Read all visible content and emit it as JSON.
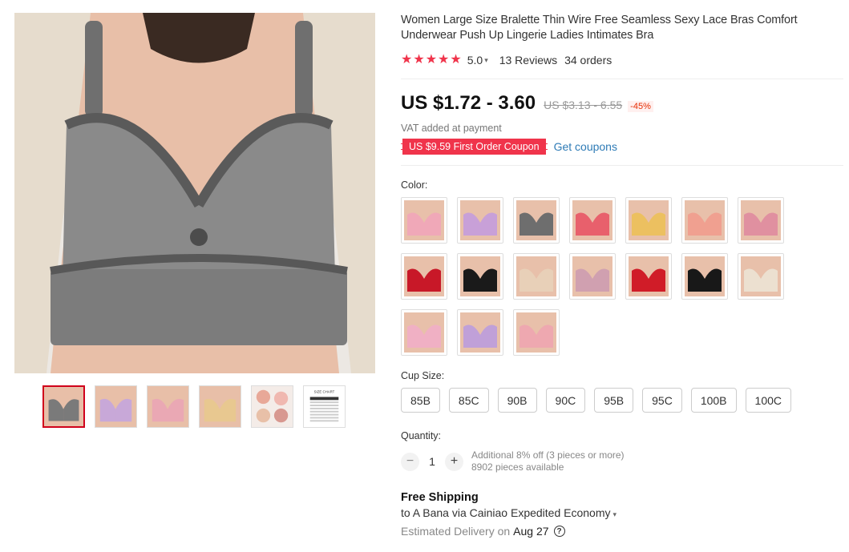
{
  "product": {
    "title": "Women Large Size Bralette Thin Wire Free Seamless Sexy Lace Bras Comfort Underwear Push Up Lingerie Ladies Intimates Bra",
    "rating_score": "5.0",
    "rating_value": 5,
    "reviews_text": "13 Reviews",
    "orders_text": "34 orders"
  },
  "gallery": {
    "thumbnails": [
      {
        "name": "gray",
        "color": "#7a7a7a"
      },
      {
        "name": "purple",
        "color": "#c8a8d8"
      },
      {
        "name": "pink",
        "color": "#eaa8b4"
      },
      {
        "name": "beige",
        "color": "#e8c890"
      },
      {
        "name": "multi",
        "color": "#e8a898"
      },
      {
        "name": "size-chart",
        "color": "#ffffff"
      }
    ],
    "size_chart_label": "SIZE CHART"
  },
  "pricing": {
    "price": "US $1.72 - 3.60",
    "original_price": "US $3.13 - 6.55",
    "discount": "-45%",
    "vat_note": "VAT added at payment",
    "coupon_text": "US $9.59 First Order Coupon",
    "get_coupons_label": "Get coupons"
  },
  "color_section": {
    "label": "Color:",
    "swatches": [
      {
        "color": "#f0a8b8"
      },
      {
        "color": "#c8a0d8"
      },
      {
        "color": "#6e6e6e"
      },
      {
        "color": "#e8606c"
      },
      {
        "color": "#ecc060"
      },
      {
        "color": "#f0a090"
      },
      {
        "color": "#e090a0"
      },
      {
        "color": "#c81828"
      },
      {
        "color": "#1a1a1a"
      },
      {
        "color": "#e8d0b8"
      },
      {
        "color": "#d0a0b0"
      },
      {
        "color": "#d01c28"
      },
      {
        "color": "#181818"
      },
      {
        "color": "#ece0d0"
      },
      {
        "color": "#f0b0c4"
      },
      {
        "color": "#c0a0d8"
      },
      {
        "color": "#eea8b0"
      }
    ]
  },
  "cup_size_section": {
    "label": "Cup Size:",
    "options": [
      "85B",
      "85C",
      "90B",
      "90C",
      "95B",
      "95C",
      "100B",
      "100C"
    ]
  },
  "quantity_section": {
    "label": "Quantity:",
    "minus": "−",
    "plus": "+",
    "value": "1",
    "additional_note": "Additional 8% off (3 pieces or more)",
    "available_note": "8902 pieces available"
  },
  "shipping": {
    "title": "Free Shipping",
    "route": "to A Bana via Cainiao Expedited Economy",
    "estimated_label": "Estimated Delivery on",
    "estimated_date": "Aug 27",
    "help_icon": "question-circle-icon"
  },
  "colors": {
    "accent_red": "#f0344b",
    "link_blue": "#2e7bb6",
    "active_border": "#d0021b"
  }
}
